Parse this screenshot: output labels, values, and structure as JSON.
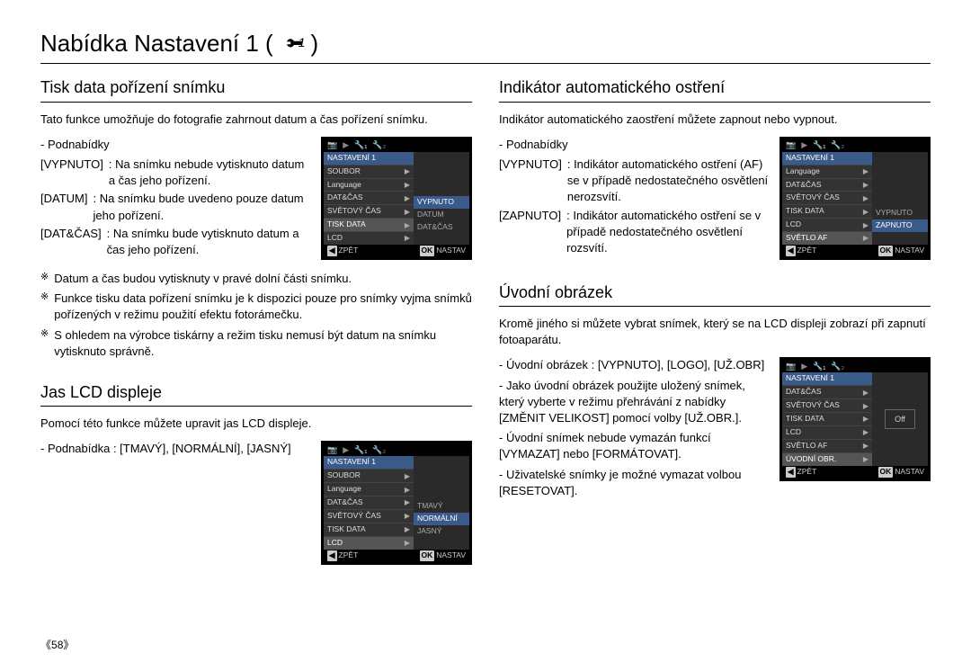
{
  "page": {
    "title_prefix": "Nabídka Nastavení 1 (",
    "title_suffix": ")",
    "icon_sub": "1",
    "number": "58"
  },
  "tisk": {
    "heading": "Tisk data pořízení snímku",
    "intro": "Tato funkce umožňuje do fotografie zahrnout datum a čas pořízení snímku.",
    "sub_label": "- Podnabídky",
    "opts": [
      {
        "key": "[VYPNUTO]",
        "val": ": Na snímku nebude vytisknuto datum a čas jeho pořízení."
      },
      {
        "key": "[DATUM]",
        "val": ": Na snímku bude uvedeno pouze datum jeho pořízení."
      },
      {
        "key": "[DAT&ČAS]",
        "val": ": Na snímku bude vytisknuto datum a čas jeho pořízení."
      }
    ],
    "notes": [
      "Datum a čas budou vytisknuty v pravé dolní části snímku.",
      "Funkce tisku data pořízení snímku je k dispozici pouze pro snímky vyjma snímků pořízených v režimu použití efektu fotorámečku.",
      "S ohledem na výrobce tiskárny a režim tisku nemusí být datum na snímku vytisknuto správně."
    ],
    "lcd": {
      "header": "NASTAVENÍ 1",
      "items": [
        "SOUBOR",
        "Language",
        "DAT&ČAS",
        "SVĚTOVÝ ČAS",
        "TISK DATA",
        "LCD"
      ],
      "sel_index": 4,
      "right": [
        "VYPNUTO",
        "DATUM",
        "DAT&ČAS"
      ],
      "right_sel": 0,
      "foot_left_key": "◀",
      "foot_left": "ZPĚT",
      "foot_right_key": "OK",
      "foot_right": "NASTAV"
    }
  },
  "jas": {
    "heading": "Jas LCD displeje",
    "intro": "Pomocí této funkce můžete upravit jas LCD displeje.",
    "sub_label": "- Podnabídka : [TMAVÝ], [NORMÁLNÍ], [JASNÝ]",
    "lcd": {
      "header": "NASTAVENÍ 1",
      "items": [
        "SOUBOR",
        "Language",
        "DAT&ČAS",
        "SVĚTOVÝ ČAS",
        "TISK DATA",
        "LCD"
      ],
      "sel_index": 5,
      "right": [
        "TMAVÝ",
        "NORMÁLNÍ",
        "JASNÝ"
      ],
      "right_sel": 1,
      "foot_left_key": "◀",
      "foot_left": "ZPĚT",
      "foot_right_key": "OK",
      "foot_right": "NASTAV"
    }
  },
  "af": {
    "heading": "Indikátor automatického ostření",
    "intro": "Indikátor automatického zaostření můžete zapnout nebo vypnout.",
    "sub_label": "- Podnabídky",
    "opts": [
      {
        "key": "[VYPNUTO]",
        "val": ": Indikátor automatického ostření (AF) se v případě nedostatečného osvětlení nerozsvítí."
      },
      {
        "key": "[ZAPNUTO]",
        "val": ": Indikátor automatického ostření se v případě nedostatečného osvětlení rozsvítí."
      }
    ],
    "lcd": {
      "header": "NASTAVENÍ 1",
      "items": [
        "Language",
        "DAT&ČAS",
        "SVĚTOVÝ ČAS",
        "TISK DATA",
        "LCD",
        "SVĚTLO AF"
      ],
      "sel_index": 5,
      "right": [
        "VYPNUTO",
        "ZAPNUTO"
      ],
      "right_sel": 1,
      "foot_left_key": "◀",
      "foot_left": "ZPĚT",
      "foot_right_key": "OK",
      "foot_right": "NASTAV"
    }
  },
  "uvod": {
    "heading": "Úvodní obrázek",
    "intro": "Kromě jiného si můžete vybrat snímek, který se na LCD displeji zobrazí při zapnutí fotoaparátu.",
    "bullets": [
      "- Úvodní obrázek : [VYPNUTO],  [LOGO], [UŽ.OBR]",
      "- Jako úvodní obrázek použijte uložený snímek, který vyberte v režimu přehrávání z nabídky [ZMĚNIT VELIKOST] pomocí volby [UŽ.OBR.].",
      "- Úvodní snímek nebude vymazán funkcí [VYMAZAT] nebo [FORMÁTOVAT].",
      "- Uživatelské snímky je možné vymazat volbou [RESETOVAT]."
    ],
    "lcd": {
      "header": "NASTAVENÍ 1",
      "items": [
        "DAT&ČAS",
        "SVĚTOVÝ ČAS",
        "TISK DATA",
        "LCD",
        "SVĚTLO AF",
        "ÚVODNÍ OBR."
      ],
      "sel_index": 5,
      "right_single": "Off",
      "foot_left_key": "◀",
      "foot_left": "ZPĚT",
      "foot_right_key": "OK",
      "foot_right": "NASTAV"
    }
  },
  "lcd_tabs": {
    "t1": "📷",
    "t2": "▶",
    "t3": "🔧₁",
    "t4": "🔧₂"
  }
}
